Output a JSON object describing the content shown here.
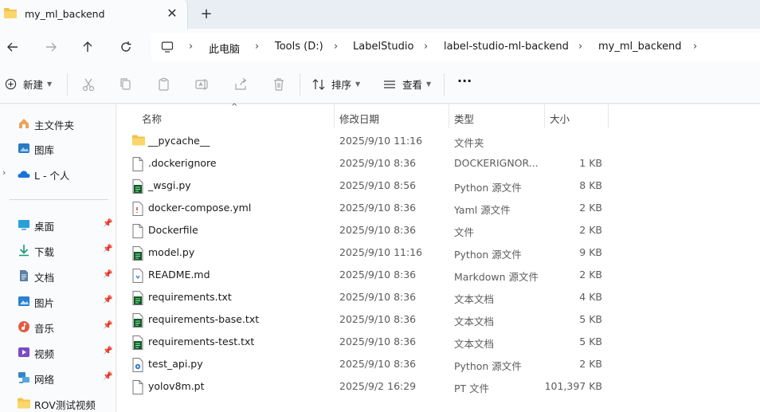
{
  "tab": {
    "title": "my_ml_backend",
    "close": "✕",
    "new": "+"
  },
  "breadcrumb": [
    "此电脑",
    "Tools (D:)",
    "LabelStudio",
    "label-studio-ml-backend",
    "my_ml_backend"
  ],
  "toolbar": {
    "new_label": "新建",
    "sort_label": "排序",
    "view_label": "查看",
    "more": "···"
  },
  "sidebar": {
    "top_items": [
      {
        "label": "主文件夹",
        "icon": "home-icon"
      },
      {
        "label": "图库",
        "icon": "gallery-icon"
      },
      {
        "label": "L - 个人",
        "icon": "onedrive-cloud-icon"
      }
    ],
    "pinned_items": [
      {
        "label": "桌面",
        "icon": "desktop-icon"
      },
      {
        "label": "下载",
        "icon": "download-icon"
      },
      {
        "label": "文档",
        "icon": "document-icon"
      },
      {
        "label": "图片",
        "icon": "pictures-icon"
      },
      {
        "label": "音乐",
        "icon": "music-icon"
      },
      {
        "label": "视频",
        "icon": "video-icon"
      },
      {
        "label": "网络",
        "icon": "network-icon"
      },
      {
        "label": "ROV测试视频",
        "icon": "folder-icon"
      }
    ]
  },
  "columns": {
    "name": "名称",
    "date": "修改日期",
    "type": "类型",
    "size": "大小"
  },
  "files": [
    {
      "name": "__pycache__",
      "date": "2025/9/10 11:16",
      "type": "文件夹",
      "size": "",
      "icon": "folder"
    },
    {
      "name": ".dockerignore",
      "date": "2025/9/10 8:36",
      "type": "DOCKERIGNOR...",
      "size": "1 KB",
      "icon": "file"
    },
    {
      "name": "_wsgi.py",
      "date": "2025/9/10 8:56",
      "type": "Python 源文件",
      "size": "8 KB",
      "icon": "python"
    },
    {
      "name": "docker-compose.yml",
      "date": "2025/9/10 8:36",
      "type": "Yaml 源文件",
      "size": "2 KB",
      "icon": "yaml"
    },
    {
      "name": "Dockerfile",
      "date": "2025/9/10 8:36",
      "type": "文件",
      "size": "2 KB",
      "icon": "file"
    },
    {
      "name": "model.py",
      "date": "2025/9/10 11:16",
      "type": "Python 源文件",
      "size": "9 KB",
      "icon": "python"
    },
    {
      "name": "README.md",
      "date": "2025/9/10 8:36",
      "type": "Markdown 源文件",
      "size": "2 KB",
      "icon": "markdown"
    },
    {
      "name": "requirements.txt",
      "date": "2025/9/10 8:36",
      "type": "文本文档",
      "size": "4 KB",
      "icon": "text"
    },
    {
      "name": "requirements-base.txt",
      "date": "2025/9/10 8:36",
      "type": "文本文档",
      "size": "5 KB",
      "icon": "text"
    },
    {
      "name": "requirements-test.txt",
      "date": "2025/9/10 8:36",
      "type": "文本文档",
      "size": "5 KB",
      "icon": "text"
    },
    {
      "name": "test_api.py",
      "date": "2025/9/10 8:36",
      "type": "Python 源文件",
      "size": "2 KB",
      "icon": "python-blue"
    },
    {
      "name": "yolov8m.pt",
      "date": "2025/9/2 16:29",
      "type": "PT 文件",
      "size": "101,397 KB",
      "icon": "file"
    }
  ]
}
